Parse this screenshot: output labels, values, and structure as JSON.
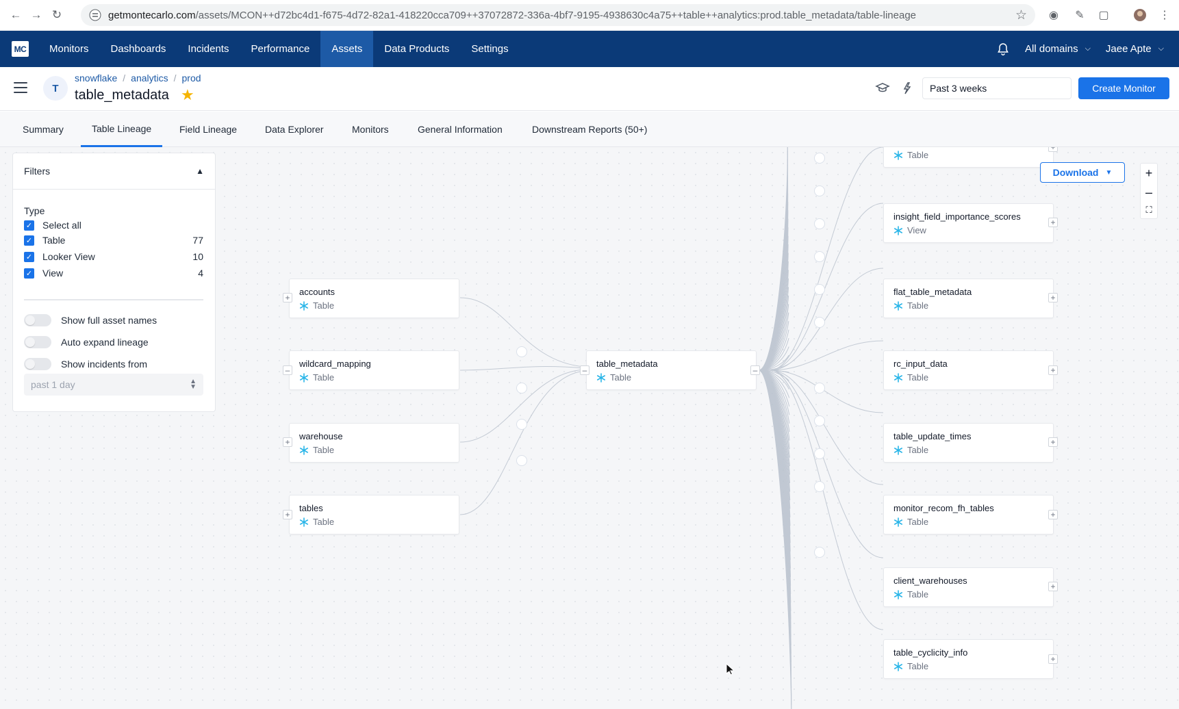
{
  "browser": {
    "url_host": "getmontecarlo.com",
    "url_path": "/assets/MCON++d72bc4d1-f675-4d72-82a1-418220cca709++37072872-336a-4bf7-9195-4938630c4a75++table++analytics:prod.table_metadata/table-lineage"
  },
  "topnav": {
    "logo": "MC",
    "items": [
      "Monitors",
      "Dashboards",
      "Incidents",
      "Performance",
      "Assets",
      "Data Products",
      "Settings"
    ],
    "active": "Assets",
    "domains": "All domains",
    "user": "Jaee Apte"
  },
  "asset": {
    "avatar": "T",
    "breadcrumb": [
      "snowflake",
      "analytics",
      "prod"
    ],
    "title": "table_metadata",
    "time_range": "Past 3 weeks",
    "create_monitor": "Create Monitor"
  },
  "tabs": [
    "Summary",
    "Table Lineage",
    "Field Lineage",
    "Data Explorer",
    "Monitors",
    "General Information",
    "Downstream Reports (50+)"
  ],
  "filters": {
    "title": "Filters",
    "type_label": "Type",
    "types": [
      {
        "label": "Select all",
        "count": ""
      },
      {
        "label": "Table",
        "count": "77"
      },
      {
        "label": "Looker View",
        "count": "10"
      },
      {
        "label": "View",
        "count": "4"
      }
    ],
    "toggles": [
      "Show full asset names",
      "Auto expand lineage",
      "Show incidents from"
    ],
    "incidents_range": "past 1 day"
  },
  "graph": {
    "download": "Download",
    "upstream": [
      {
        "name": "accounts",
        "type": "Table"
      },
      {
        "name": "wildcard_mapping",
        "type": "Table"
      },
      {
        "name": "warehouse",
        "type": "Table"
      },
      {
        "name": "tables",
        "type": "Table"
      }
    ],
    "center": {
      "name": "table_metadata",
      "type": "Table"
    },
    "downstream": [
      {
        "name": "",
        "type": "Table"
      },
      {
        "name": "insight_field_importance_scores",
        "type": "View"
      },
      {
        "name": "flat_table_metadata",
        "type": "Table"
      },
      {
        "name": "rc_input_data",
        "type": "Table"
      },
      {
        "name": "table_update_times",
        "type": "Table"
      },
      {
        "name": "monitor_recom_fh_tables",
        "type": "Table"
      },
      {
        "name": "client_warehouses",
        "type": "Table"
      },
      {
        "name": "table_cyclicity_info",
        "type": "Table"
      }
    ]
  },
  "colors": {
    "nav": "#0b3a78",
    "accent": "#1a73e8",
    "star": "#f5b400",
    "snowflake": "#29b5e8"
  }
}
